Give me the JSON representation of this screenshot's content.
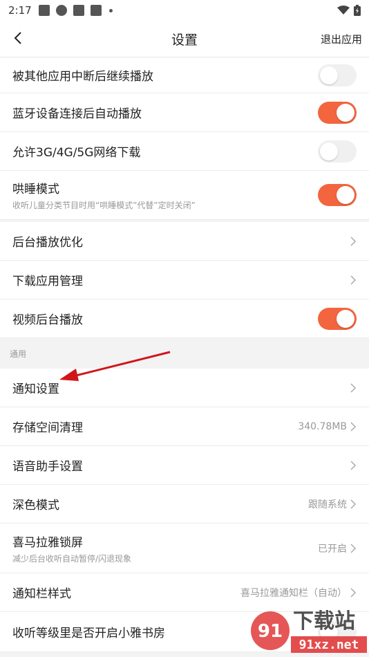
{
  "status_bar": {
    "time": "2:17"
  },
  "header": {
    "title": "设置",
    "exit_label": "退出应用"
  },
  "playback": [
    {
      "name": "interrupt-resume",
      "label": "被其他应用中断后继续播放",
      "type": "toggle",
      "on": false
    },
    {
      "name": "bluetooth-autoplay",
      "label": "蓝牙设备连接后自动播放",
      "type": "toggle",
      "on": true
    },
    {
      "name": "mobile-download",
      "label": "允许3G/4G/5G网络下载",
      "type": "toggle",
      "on": false
    },
    {
      "name": "sleep-mode",
      "label": "哄睡模式",
      "sub": "收听儿童分类节目时用“哄睡模式”代替”定时关闭”",
      "type": "toggle",
      "on": true
    }
  ],
  "background": [
    {
      "name": "background-optimize",
      "label": "后台播放优化",
      "type": "link"
    },
    {
      "name": "download-manager",
      "label": "下载应用管理",
      "type": "link"
    },
    {
      "name": "video-background",
      "label": "视频后台播放",
      "type": "toggle",
      "on": true
    }
  ],
  "general_section": {
    "title": "通用",
    "items": [
      {
        "name": "notification-settings",
        "label": "通知设置",
        "type": "link"
      },
      {
        "name": "storage-cleanup",
        "label": "存储空间清理",
        "value": "340.78MB",
        "type": "link"
      },
      {
        "name": "voice-assistant",
        "label": "语音助手设置",
        "type": "link"
      },
      {
        "name": "dark-mode",
        "label": "深色模式",
        "value": "跟随系统",
        "type": "link"
      },
      {
        "name": "lock-screen",
        "label": "喜马拉雅锁屏",
        "sub": "减少后台收听自动暂停/闪退现象",
        "value": "已开启",
        "type": "link"
      },
      {
        "name": "notification-bar-style",
        "label": "通知栏样式",
        "value": "喜马拉雅通知栏（自动）",
        "type": "link"
      },
      {
        "name": "study-room",
        "label": "收听等级里是否开启小雅书房",
        "type": "toggle",
        "on": false
      }
    ]
  },
  "colors": {
    "accent": "#f3653e",
    "arrow": "#d0161b"
  },
  "watermark": {
    "text1": "下载站",
    "text2": "91xz.net"
  }
}
